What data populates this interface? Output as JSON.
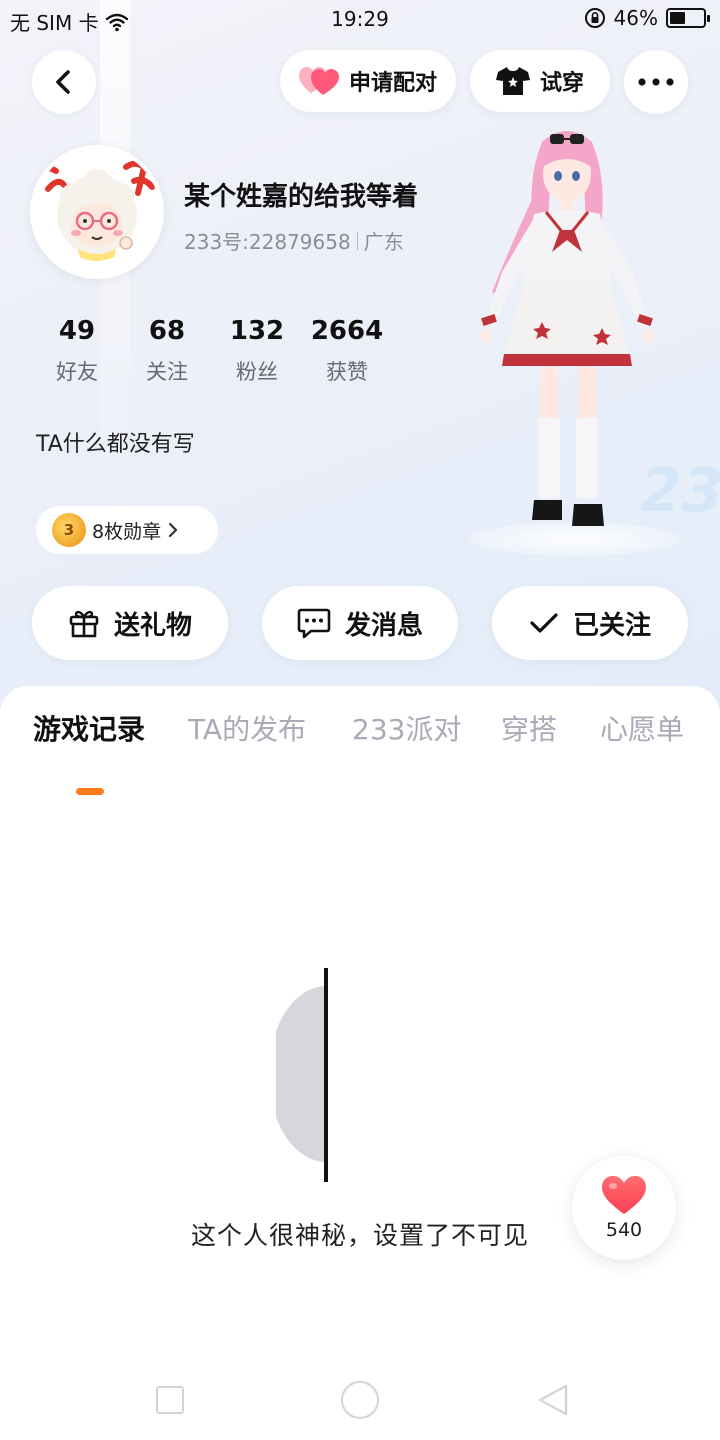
{
  "status_bar": {
    "carrier": "无 SIM 卡",
    "time": "19:29",
    "battery": "46%",
    "battery_level": 0.46
  },
  "header": {
    "back_icon": "chevron-left-icon",
    "pair_label": "申请配对",
    "try_on_label": "试穿",
    "more_icon": "more-dots-icon"
  },
  "profile": {
    "nickname": "某个姓嘉的给我等着",
    "uid": "233号:22879658",
    "region": "广东",
    "bio": "TA什么都没有写",
    "medal_label": "8枚勋章",
    "medal_number": "3"
  },
  "stats": [
    {
      "value": "49",
      "label": "好友"
    },
    {
      "value": "68",
      "label": "关注"
    },
    {
      "value": "132",
      "label": "粉丝"
    },
    {
      "value": "2664",
      "label": "获赞"
    }
  ],
  "actions": {
    "gift": "送礼物",
    "message": "发消息",
    "follow": "已关注"
  },
  "tabs": [
    "游戏记录",
    "TA的发布",
    "233派对",
    "穿搭",
    "心愿单"
  ],
  "active_tab": "游戏记录",
  "empty_state": {
    "text": "这个人很神秘，设置了不可见"
  },
  "like_fab": {
    "count": "540"
  },
  "colors": {
    "accent": "#ff7a1a",
    "heart": "#ff4b57"
  }
}
